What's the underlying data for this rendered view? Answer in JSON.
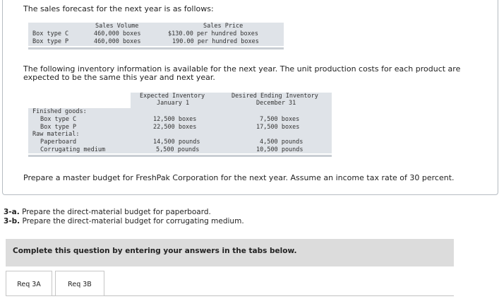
{
  "intro_text": "The sales forecast for the next year is as follows:",
  "sales_table": {
    "headers": {
      "volume": "Sales Volume",
      "price": "Sales Price"
    },
    "rows": [
      {
        "product": "Box type C",
        "volume": "460,000 boxes",
        "price": "$130.00 per hundred boxes"
      },
      {
        "product": "Box type P",
        "volume": "460,000 boxes",
        "price": "190.00 per hundred boxes"
      }
    ]
  },
  "inventory_intro": "The following inventory information is available for the next year. The unit production costs for each product are expected to be the same this year and next year.",
  "inventory_table": {
    "headers": {
      "expected_line1": "Expected Inventory",
      "expected_line2": "January 1",
      "desired_line1": "Desired Ending Inventory",
      "desired_line2": "December 31"
    },
    "rows": [
      {
        "label": "Finished goods:",
        "expected": "",
        "desired": ""
      },
      {
        "label": "Box type C",
        "expected": "12,500 boxes",
        "desired": "7,500 boxes"
      },
      {
        "label": "Box type P",
        "expected": "22,500 boxes",
        "desired": "17,500 boxes"
      },
      {
        "label": "Raw material:",
        "expected": "",
        "desired": ""
      },
      {
        "label": "Paperboard",
        "expected": "14,500 pounds",
        "desired": "4,500 pounds"
      },
      {
        "label": "Corrugating medium",
        "expected": "5,500 pounds",
        "desired": "10,500 pounds"
      }
    ]
  },
  "prepare_text": "Prepare a master budget for FreshPak Corporation for the next year. Assume an income tax rate of 30 percent.",
  "questions": [
    {
      "id": "3-a.",
      "text": "Prepare the direct-material budget for paperboard."
    },
    {
      "id": "3-b.",
      "text": "Prepare the direct-material budget for corrugating medium."
    }
  ],
  "banner_text": "Complete this question by entering your answers in the tabs below.",
  "tabs": [
    "Req 3A",
    "Req 3B"
  ]
}
